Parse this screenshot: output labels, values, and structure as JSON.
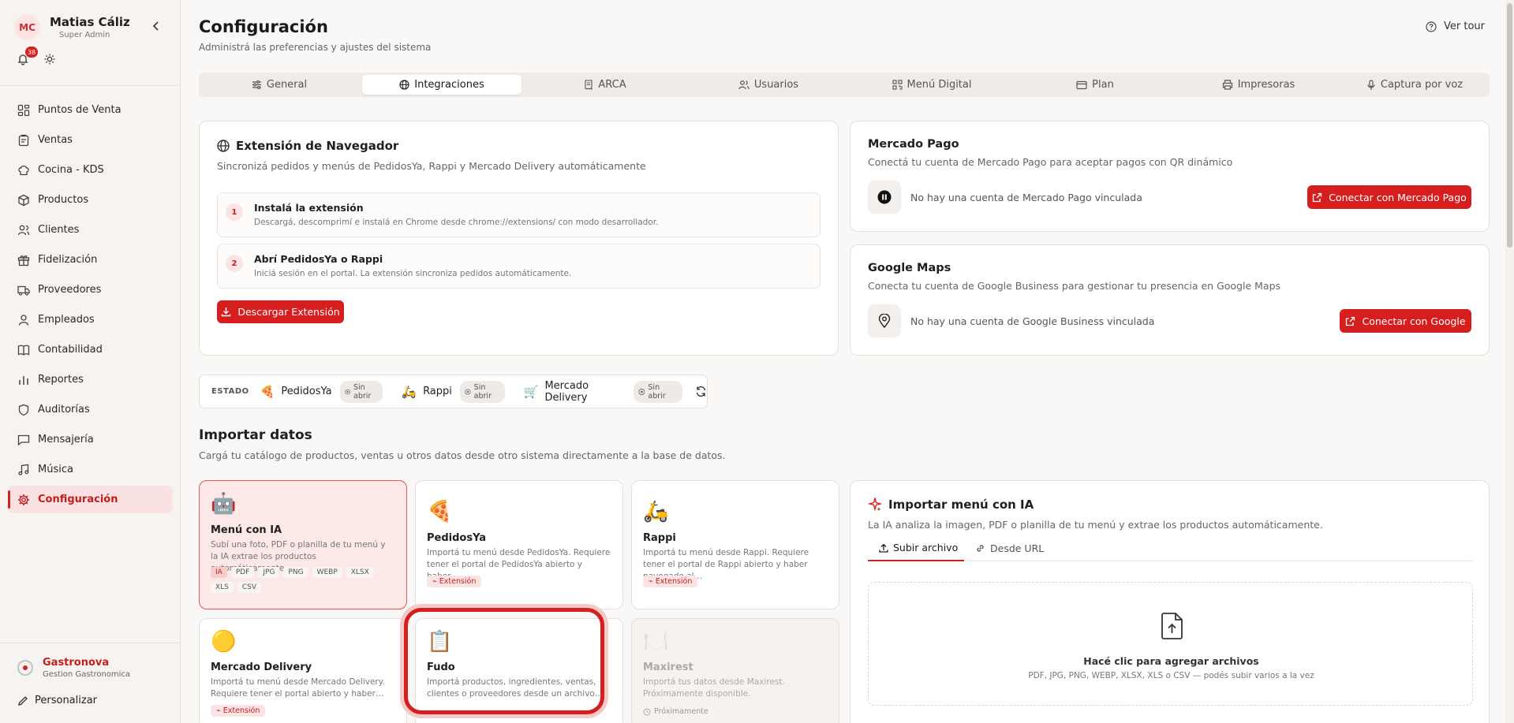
{
  "user": {
    "initials": "MC",
    "name": "Matias Cáliz",
    "role": "Super Admin",
    "notifications": "38"
  },
  "nav": [
    {
      "label": "Puntos de Venta",
      "icon": "grid-icon"
    },
    {
      "label": "Ventas",
      "icon": "clipboard-icon"
    },
    {
      "label": "Cocina - KDS",
      "icon": "chef-hat-icon"
    },
    {
      "label": "Productos",
      "icon": "box-icon"
    },
    {
      "label": "Clientes",
      "icon": "users-icon"
    },
    {
      "label": "Fidelización",
      "icon": "gift-icon"
    },
    {
      "label": "Proveedores",
      "icon": "truck-icon"
    },
    {
      "label": "Empleados",
      "icon": "user-icon"
    },
    {
      "label": "Contabilidad",
      "icon": "book-icon"
    },
    {
      "label": "Reportes",
      "icon": "bar-chart-icon"
    },
    {
      "label": "Auditorías",
      "icon": "shield-icon"
    },
    {
      "label": "Mensajería",
      "icon": "message-icon"
    },
    {
      "label": "Música",
      "icon": "music-icon"
    },
    {
      "label": "Configuración",
      "icon": "gear-icon"
    }
  ],
  "brand": {
    "name": "Gastronova",
    "sub": "Gestion Gastronomica"
  },
  "personalize_label": "Personalizar",
  "header": {
    "title": "Configuración",
    "subtitle": "Administrá las preferencias y ajustes del sistema",
    "tour_label": "Ver tour"
  },
  "tabs": [
    "General",
    "Integraciones",
    "ARCA",
    "Usuarios",
    "Menú Digital",
    "Plan",
    "Impresoras",
    "Captura por voz"
  ],
  "active_tab": "Integraciones",
  "extension": {
    "title": "Extensión de Navegador",
    "subtitle": "Sincronizá pedidos y menús de PedidosYa, Rappi y Mercado Delivery automáticamente",
    "steps": [
      {
        "num": "1",
        "title": "Instalá la extensión",
        "desc": "Descargá, descomprimí e instalá en Chrome desde chrome://extensions/ con modo desarrollador."
      },
      {
        "num": "2",
        "title": "Abrí PedidosYa o Rappi",
        "desc": "Iniciá sesión en el portal. La extensión sincroniza pedidos automáticamente."
      }
    ],
    "download_label": "Descargar Extensión"
  },
  "mercado_pago": {
    "title": "Mercado Pago",
    "subtitle": "Conectá tu cuenta de Mercado Pago para aceptar pagos con QR dinámico",
    "status": "No hay una cuenta de Mercado Pago vinculada",
    "button": "Conectar con Mercado Pago"
  },
  "google_maps": {
    "title": "Google Maps",
    "subtitle": "Conecta tu cuenta de Google Business para gestionar tu presencia en Google Maps",
    "status": "No hay una cuenta de Google Business vinculada",
    "button": "Conectar con Google"
  },
  "estado": {
    "label": "ESTADO",
    "platforms": [
      {
        "emoji": "🍕",
        "name": "PedidosYa",
        "status": "Sin abrir"
      },
      {
        "emoji": "🛵",
        "name": "Rappi",
        "status": "Sin abrir"
      },
      {
        "emoji": "🛒",
        "name": "Mercado Delivery",
        "status": "Sin abrir"
      }
    ]
  },
  "import": {
    "title": "Importar datos",
    "subtitle": "Cargá tu catálogo de productos, ventas u otros datos desde otro sistema directamente a la base de datos.",
    "tiles": [
      {
        "emoji": "🤖",
        "name": "Menú con IA",
        "desc": "Subí una foto, PDF o planilla de tu menú y la IA extrae los productos automáticamente."
      },
      {
        "emoji": "🍕",
        "name": "PedidosYa",
        "desc": "Importá tu menú desde PedidosYa. Requiere tener el portal de PedidosYa abierto y haber…",
        "tag": "Extensión"
      },
      {
        "emoji": "🛵",
        "name": "Rappi",
        "desc": "Importá tu menú desde Rappi. Requiere tener el portal de Rappi abierto y haber navegado al…",
        "tag": "Extensión"
      },
      {
        "emoji": "🟡",
        "name": "Mercado Delivery",
        "desc": "Importá tu menú desde Mercado Delivery. Requiere tener el portal abierto y haber…",
        "tag": "Extensión"
      },
      {
        "emoji": "📋",
        "name": "Fudo",
        "desc": "Importá productos, ingredientes, ventas, clientes o proveedores desde un archivo…"
      },
      {
        "emoji": "🍽️",
        "name": "Maxirest",
        "desc": "Importá tus datos desde Maxirest. Próximamente disponible.",
        "tag": "Próximamente"
      }
    ],
    "formats": [
      "IA",
      "PDF",
      "JPG",
      "PNG",
      "WEBP",
      "XLSX",
      "XLS",
      "CSV"
    ]
  },
  "ia_import": {
    "title": "Importar menú con IA",
    "subtitle": "La IA analiza la imagen, PDF o planilla de tu menú y extrae los productos automáticamente.",
    "tabs": [
      "Subir archivo",
      "Desde URL"
    ],
    "drop_title": "Hacé clic para agregar archivos",
    "drop_sub": "PDF, JPG, PNG, WEBP, XLSX, XLS o CSV — podés subir varios a la vez"
  },
  "colors": {
    "accent": "#d71e1e",
    "accent_soft": "#fde4e4",
    "background": "#faf8f6"
  }
}
